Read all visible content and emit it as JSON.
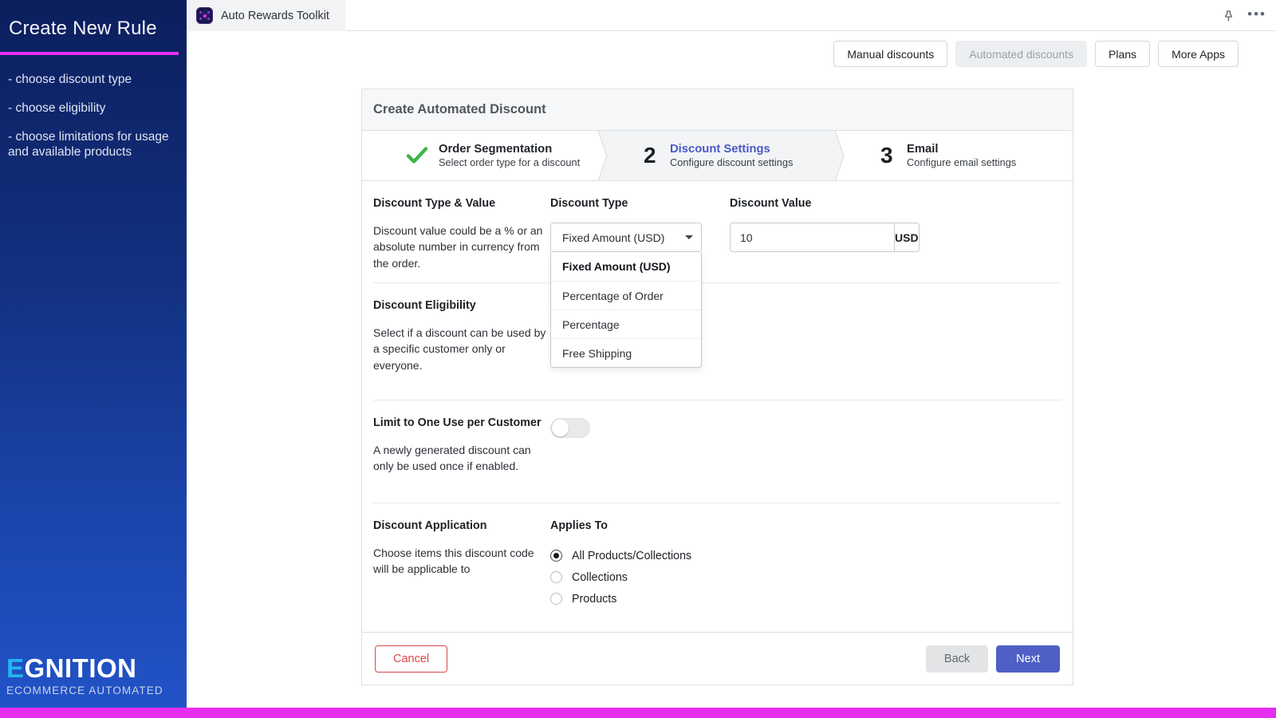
{
  "sidebar": {
    "title": "Create New Rule",
    "accent_color": "#e22ef0",
    "items": [
      "- choose discount type",
      "- choose eligibility",
      "- choose limitations for usage and available products"
    ],
    "logo": {
      "first_letter": "E",
      "rest": "GNITION",
      "tagline": "ECOMMERCE AUTOMATED"
    }
  },
  "topbar": {
    "app_title": "Auto Rewards Toolkit",
    "app_icon": "atom-icon",
    "pin_icon": "pin-icon",
    "overflow_icon": "ellipsis-icon",
    "overflow_label": "•••"
  },
  "nav": {
    "buttons": [
      {
        "label": "Manual discounts",
        "disabled": false
      },
      {
        "label": "Automated discounts",
        "disabled": true
      },
      {
        "label": "Plans",
        "disabled": false
      },
      {
        "label": "More Apps",
        "disabled": false
      }
    ]
  },
  "card": {
    "header_title": "Create Automated Discount",
    "steps": [
      {
        "marker": "check",
        "title": "Order Segmentation",
        "sub": "Select order type for a discount",
        "state": "complete"
      },
      {
        "marker": "2",
        "title": "Discount Settings",
        "sub": "Configure discount settings",
        "state": "active"
      },
      {
        "marker": "3",
        "title": "Email",
        "sub": "Configure email settings",
        "state": "upcoming"
      }
    ],
    "sections": [
      {
        "heading": "Discount Type & Value",
        "description": "Discount value could be a % or an absolute number in currency from the order.",
        "field_label": "Discount Type",
        "field2_label": "Discount Value"
      },
      {
        "heading": "Discount Eligibility",
        "description": "Select if a discount can be used by a specific customer only or everyone."
      },
      {
        "heading": "Limit to One Use per Customer",
        "description": "A newly generated discount can only be used once if enabled.",
        "toggle_state": "off"
      },
      {
        "heading": "Discount Application",
        "description": "Choose items this discount code will be applicable to",
        "field_label": "Applies To"
      }
    ],
    "discount_type": {
      "selected": "Fixed Amount (USD)",
      "open": true,
      "options": [
        "Fixed Amount (USD)",
        "Percentage of Order",
        "Percentage",
        "Free Shipping"
      ]
    },
    "discount_value": {
      "value": "10",
      "placeholder": "",
      "suffix": "USD"
    },
    "applies_to": {
      "options": [
        "All Products/Collections",
        "Collections",
        "Products"
      ],
      "selected_index": 0
    },
    "footer": {
      "cancel": "Cancel",
      "back": "Back",
      "next": "Next"
    }
  },
  "colors": {
    "accent_magenta": "#e62ef0",
    "primary_blue": "#4f5fc6",
    "step_active_blue": "#4b59c9",
    "check_green": "#3cb44a",
    "cancel_red": "#d94848"
  }
}
